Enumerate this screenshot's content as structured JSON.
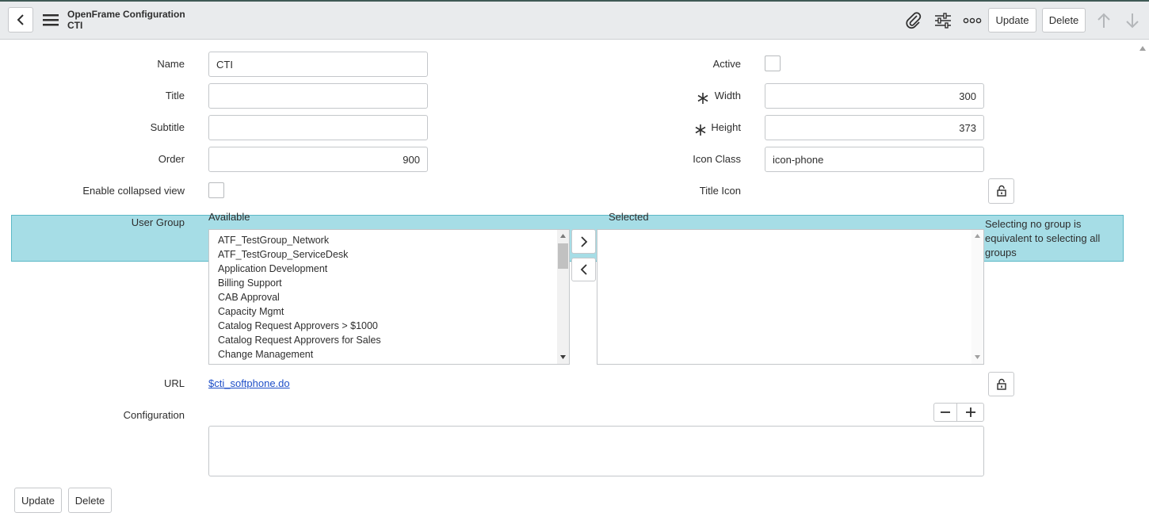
{
  "header": {
    "title": "OpenFrame Configuration",
    "subtitle": "CTI",
    "update_label": "Update",
    "delete_label": "Delete"
  },
  "form": {
    "name_label": "Name",
    "name_value": "CTI",
    "title_label": "Title",
    "title_value": "",
    "subtitle_label": "Subtitle",
    "subtitle_value": "",
    "order_label": "Order",
    "order_value": "900",
    "collapsed_label": "Enable collapsed view",
    "collapsed_checked": false,
    "active_label": "Active",
    "active_checked": false,
    "width_label": "Width",
    "width_value": "300",
    "height_label": "Height",
    "height_value": "373",
    "iconclass_label": "Icon Class",
    "iconclass_value": "icon-phone",
    "titleicon_label": "Title Icon",
    "usergroup_label": "User Group",
    "available_label": "Available",
    "selected_label": "Selected",
    "available_items": [
      "ATF_TestGroup_Network",
      "ATF_TestGroup_ServiceDesk",
      "Application Development",
      "Billing Support",
      "CAB Approval",
      "Capacity Mgmt",
      "Catalog Request Approvers > $1000",
      "Catalog Request Approvers for Sales",
      "Change Management"
    ],
    "selected_items": [],
    "usergroup_note": "Selecting no group is equivalent to selecting all groups",
    "url_label": "URL",
    "url_value": "$cti_softphone.do",
    "configuration_label": "Configuration",
    "configuration_value": ""
  },
  "footer": {
    "update_label": "Update",
    "delete_label": "Delete"
  },
  "icons": {
    "back": "chevron-left-icon",
    "menu": "hamburger-menu-icon",
    "attachment": "paperclip-icon",
    "personalize": "sliders-icon",
    "more": "more-options-icon",
    "prev": "arrow-up-icon",
    "next": "arrow-down-icon",
    "lock": "lock-icon",
    "required": "asterisk-icon"
  },
  "colors": {
    "header_bg": "#e9ebed",
    "note_bg": "#a6dde6",
    "note_border": "#5cb8c6",
    "link": "#1f4fc8"
  }
}
